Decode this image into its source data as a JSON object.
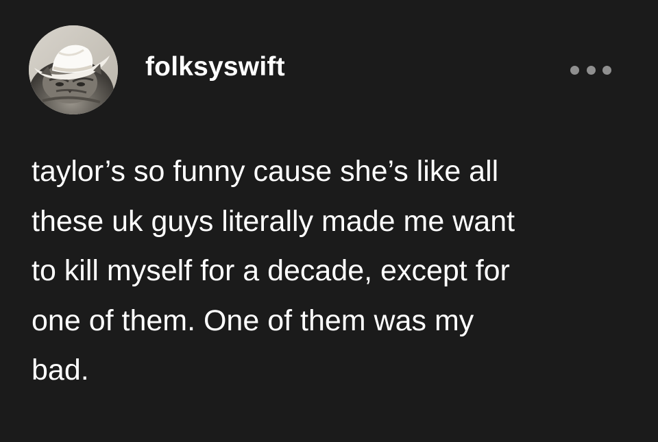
{
  "post": {
    "author": {
      "username": "folksyswift",
      "avatar_icon": "cat-in-cowboy-hat-avatar"
    },
    "more_icon": "ellipsis-icon",
    "text_lines": [
      "taylor’s so funny cause she’s like all",
      "these uk guys literally made me want",
      "to kill myself for a decade, except for",
      "one of them. One of them was my",
      "bad."
    ]
  },
  "colors": {
    "background": "#1b1b1b",
    "text": "#ffffff",
    "more_dots": "#8f8f8f"
  }
}
